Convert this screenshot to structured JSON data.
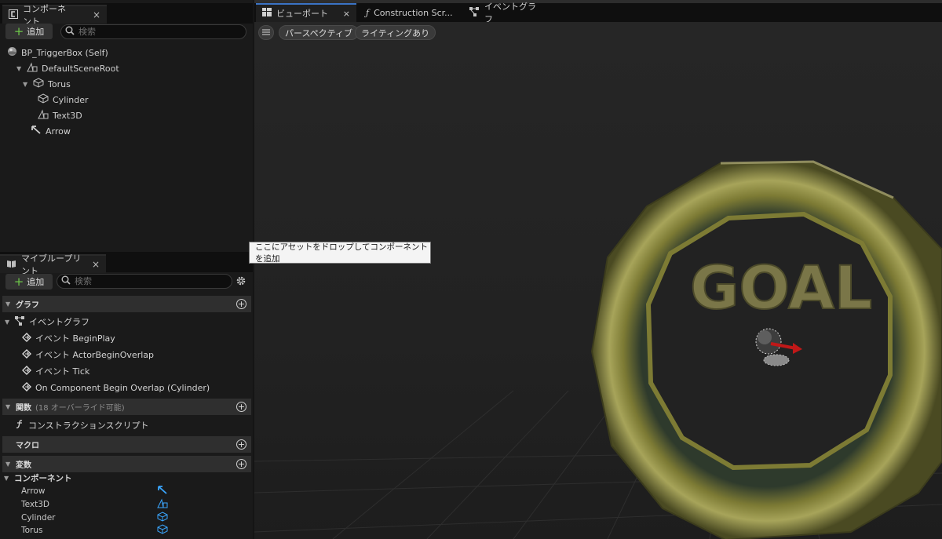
{
  "components_panel": {
    "tab_label": "コンポーネント",
    "close_label": "×",
    "add_label": "追加",
    "search_placeholder": "検索",
    "tree": [
      {
        "label": "BP_TriggerBox (Self)"
      },
      {
        "label": "DefaultSceneRoot"
      },
      {
        "label": "Torus"
      },
      {
        "label": "Cylinder"
      },
      {
        "label": "Text3D"
      },
      {
        "label": "Arrow"
      }
    ]
  },
  "my_blueprint": {
    "tab_label": "マイブループリント",
    "close_label": "×",
    "add_label": "追加",
    "search_placeholder": "検索",
    "sections": {
      "graph": {
        "label": "グラフ"
      },
      "functions": {
        "label": "関数",
        "sub": "(18 オーバーライド可能)"
      },
      "macros": {
        "label": "マクロ"
      },
      "variables": {
        "label": "変数"
      }
    },
    "event_graph": {
      "label": "イベントグラフ"
    },
    "events": [
      {
        "label": "イベント BeginPlay"
      },
      {
        "label": "イベント ActorBeginOverlap"
      },
      {
        "label": "イベント Tick"
      },
      {
        "label": "On Component Begin Overlap (Cylinder)"
      }
    ],
    "construction_script": {
      "label": "コンストラクションスクリプト"
    },
    "components_group": {
      "label": "コンポーネント"
    },
    "variables": [
      {
        "name": "Arrow"
      },
      {
        "name": "Text3D"
      },
      {
        "name": "Cylinder"
      },
      {
        "name": "Torus"
      }
    ]
  },
  "viewport": {
    "tabs": [
      {
        "label": "ビューポート",
        "close": "×"
      },
      {
        "label": "Construction Scr..."
      },
      {
        "label": "イベントグラフ"
      }
    ],
    "view_mode": "パースペクティブ",
    "lighting": "ライティングあり",
    "goal_text": "GOAL"
  },
  "tooltip": {
    "text": "ここにアセットをドロップしてコンポーネントを追加"
  },
  "colors": {
    "accent_blue": "#3a73c4",
    "add_green": "#6ec84a",
    "arrow_red": "#c01818",
    "ring_gold": "#8a8a3a"
  }
}
